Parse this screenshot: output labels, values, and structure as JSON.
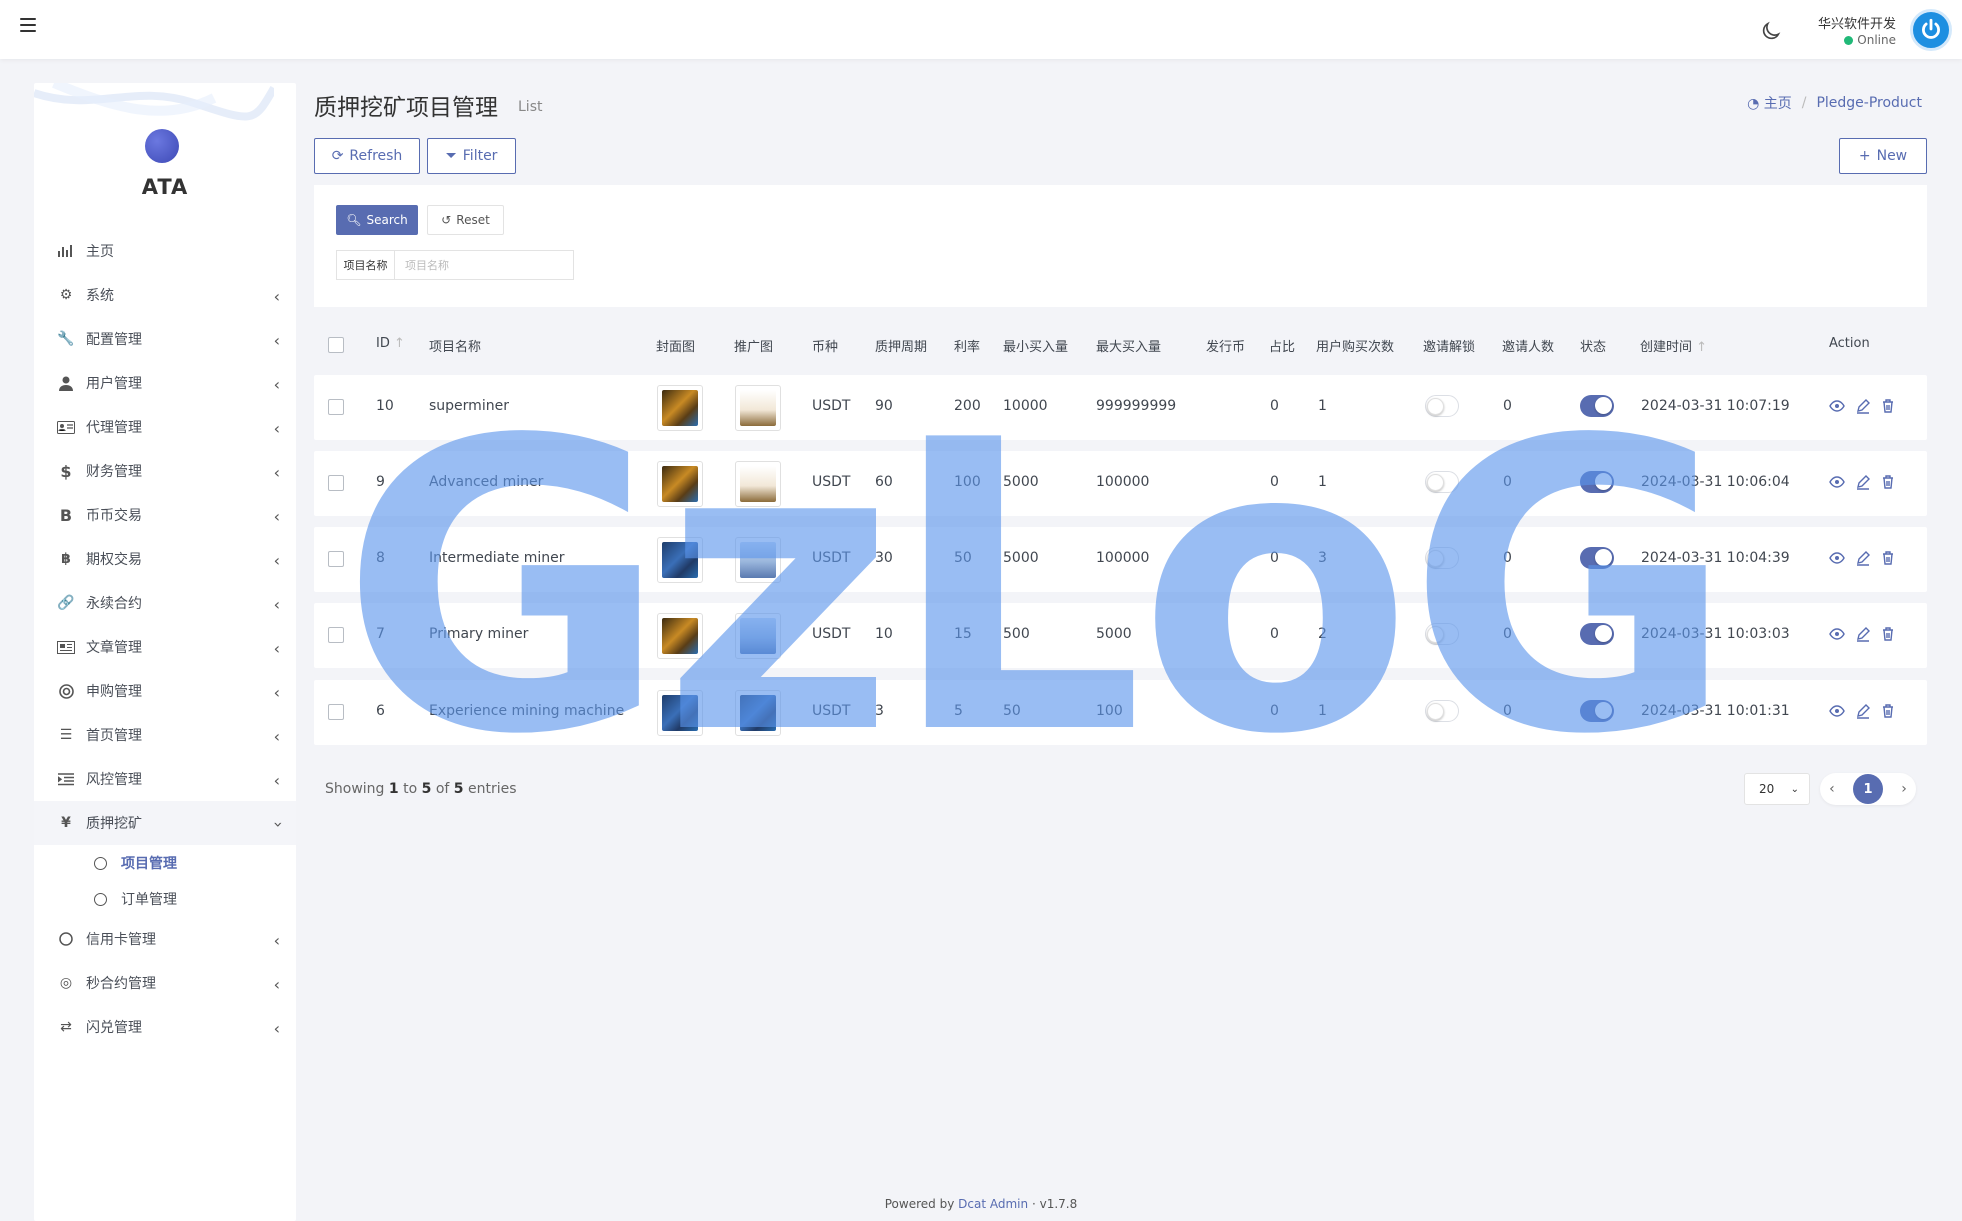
{
  "topbar": {
    "user_name": "华兴软件开发",
    "user_status": "Online"
  },
  "sidebar": {
    "logo_text": "ATA",
    "items": [
      {
        "label": "主页",
        "icon": "bar-chart-icon",
        "has_children": false
      },
      {
        "label": "系统",
        "icon": "gear-icon",
        "has_children": true
      },
      {
        "label": "配置管理",
        "icon": "wrench-icon",
        "has_children": true
      },
      {
        "label": "用户管理",
        "icon": "user-tie-icon",
        "has_children": true
      },
      {
        "label": "代理管理",
        "icon": "id-card-icon",
        "has_children": true
      },
      {
        "label": "财务管理",
        "icon": "dollar-icon",
        "has_children": true
      },
      {
        "label": "币币交易",
        "icon": "bitcoin-b-icon",
        "has_children": true
      },
      {
        "label": "期权交易",
        "icon": "bitcoin-circle-icon",
        "has_children": true
      },
      {
        "label": "永续合约",
        "icon": "link-icon",
        "has_children": true
      },
      {
        "label": "文章管理",
        "icon": "newspaper-icon",
        "has_children": true
      },
      {
        "label": "申购管理",
        "icon": "life-ring-icon",
        "has_children": true
      },
      {
        "label": "首页管理",
        "icon": "list-icon",
        "has_children": true
      },
      {
        "label": "风控管理",
        "icon": "indent-icon",
        "has_children": true
      },
      {
        "label": "质押挖矿",
        "icon": "yen-icon",
        "has_children": true,
        "expanded": true,
        "children": [
          {
            "label": "项目管理",
            "current": true
          },
          {
            "label": "订单管理",
            "current": false
          }
        ]
      },
      {
        "label": "信用卡管理",
        "icon": "circle-icon",
        "has_children": true
      },
      {
        "label": "秒合约管理",
        "icon": "coins-icon",
        "has_children": true
      },
      {
        "label": "闪兑管理",
        "icon": "exchange-icon",
        "has_children": true
      }
    ]
  },
  "page": {
    "title": "质押挖矿项目管理",
    "subtitle": "List",
    "breadcrumb": [
      "主页",
      "Pledge-Product"
    ]
  },
  "toolbar": {
    "refresh": "Refresh",
    "filter": "Filter",
    "new": "New"
  },
  "filter": {
    "search": "Search",
    "reset": "Reset",
    "field_label": "项目名称",
    "field_placeholder": "项目名称"
  },
  "table": {
    "headers": {
      "id": "ID",
      "name": "项目名称",
      "cover": "封面图",
      "promo": "推广图",
      "currency": "币种",
      "period": "质押周期",
      "rate": "利率",
      "min_buy": "最小买入量",
      "max_buy": "最大买入量",
      "issue_coin": "发行币",
      "ratio": "占比",
      "buy_times": "用户购买次数",
      "invite_unlock": "邀请解锁",
      "invite_count": "邀请人数",
      "status": "状态",
      "created": "创建时间",
      "action": "Action"
    },
    "rows": [
      {
        "id": "10",
        "name": "superminer",
        "currency": "USDT",
        "period": "90",
        "rate": "200",
        "min_buy": "10000",
        "max_buy": "999999999",
        "issue_coin": "",
        "ratio": "0",
        "buy_times": "1",
        "invite_unlock": false,
        "invite_count": "0",
        "status": true,
        "created": "2024-03-31 10:07:19"
      },
      {
        "id": "9",
        "name": "Advanced miner",
        "currency": "USDT",
        "period": "60",
        "rate": "100",
        "min_buy": "5000",
        "max_buy": "100000",
        "issue_coin": "",
        "ratio": "0",
        "buy_times": "1",
        "invite_unlock": false,
        "invite_count": "0",
        "status": true,
        "created": "2024-03-31 10:06:04"
      },
      {
        "id": "8",
        "name": "Intermediate miner",
        "currency": "USDT",
        "period": "30",
        "rate": "50",
        "min_buy": "5000",
        "max_buy": "100000",
        "issue_coin": "",
        "ratio": "0",
        "buy_times": "3",
        "invite_unlock": false,
        "invite_count": "0",
        "status": true,
        "created": "2024-03-31 10:04:39"
      },
      {
        "id": "7",
        "name": "Primary miner",
        "currency": "USDT",
        "period": "10",
        "rate": "15",
        "min_buy": "500",
        "max_buy": "5000",
        "issue_coin": "",
        "ratio": "0",
        "buy_times": "2",
        "invite_unlock": false,
        "invite_count": "0",
        "status": true,
        "created": "2024-03-31 10:03:03"
      },
      {
        "id": "6",
        "name": "Experience mining machine",
        "currency": "USDT",
        "period": "3",
        "rate": "5",
        "min_buy": "50",
        "max_buy": "100",
        "issue_coin": "",
        "ratio": "0",
        "buy_times": "1",
        "invite_unlock": false,
        "invite_count": "0",
        "status": true,
        "created": "2024-03-31 10:01:31"
      }
    ]
  },
  "pagination": {
    "showing_prefix": "Showing",
    "from": "1",
    "to_word": "to",
    "to": "5",
    "of_word": "of",
    "total": "5",
    "entries_word": "entries",
    "per_page": "20",
    "current_page": "1"
  },
  "watermark": "GzLoG",
  "footer": {
    "powered_by": "Powered by",
    "product": "Dcat Admin",
    "dot": "·",
    "version": "v1.7.8"
  },
  "colors": {
    "primary": "#586cb1",
    "online": "#21b978",
    "watermark": "#5b94eb"
  }
}
